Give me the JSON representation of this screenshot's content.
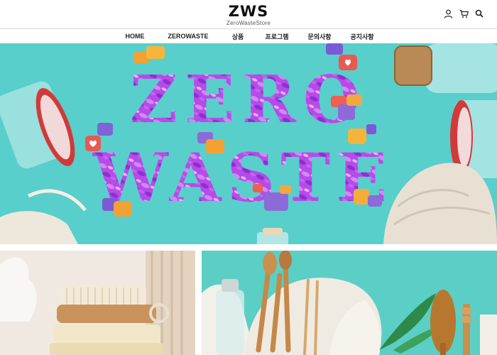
{
  "header": {
    "logo_title": "ZWS",
    "logo_subtitle": "ZeroWasteStore",
    "icons": [
      "user-icon",
      "cart-icon",
      "search-icon"
    ]
  },
  "nav": {
    "items": [
      {
        "label": "HOME"
      },
      {
        "label": "ZEROWASTE"
      },
      {
        "label": "상품"
      },
      {
        "label": "프로그램"
      },
      {
        "label": "문의사항"
      },
      {
        "label": "공지사항"
      }
    ]
  },
  "hero": {
    "headline_line1": "ZERO",
    "headline_line2": "WASTE",
    "background_color": "#58cfcb",
    "letter_color": "#b44ae6"
  },
  "colors": {
    "accent_purple": "#a146e0",
    "teal": "#58cfcb"
  }
}
